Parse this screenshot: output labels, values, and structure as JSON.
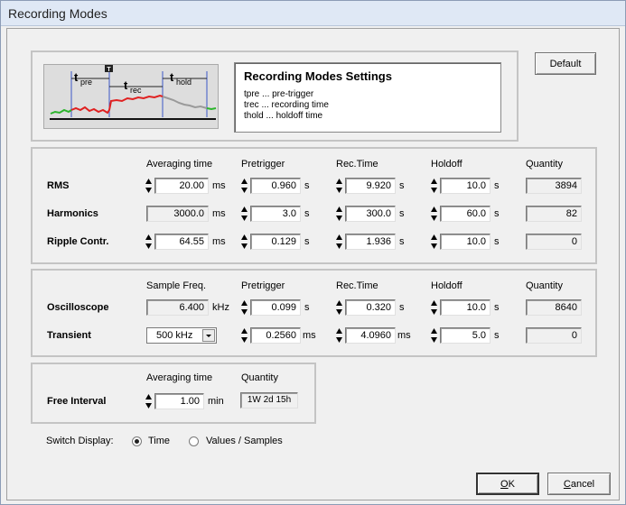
{
  "window": {
    "title": "Recording Modes"
  },
  "top": {
    "settings_title": "Recording Modes Settings",
    "legend": [
      "tpre ... pre-trigger",
      "trec ... recording time",
      "thold ... holdoff time"
    ],
    "diagram": {
      "tpre": "pre",
      "trec": "rec",
      "thold": "hold",
      "t": "t",
      "trigger_marker": "T"
    },
    "default_button": "Default"
  },
  "group1": {
    "headers": [
      "Averaging time",
      "Pretrigger",
      "Rec.Time",
      "Holdoff",
      "Quantity"
    ],
    "rows": [
      {
        "label": "RMS",
        "avg": "20.00",
        "avg_unit": "ms",
        "pre": "0.960",
        "pre_unit": "s",
        "rec": "9.920",
        "rec_unit": "s",
        "hold": "10.0",
        "hold_unit": "s",
        "qty": "3894"
      },
      {
        "label": "Harmonics",
        "avg": "3000.0",
        "avg_unit": "ms",
        "pre": "3.0",
        "pre_unit": "s",
        "rec": "300.0",
        "rec_unit": "s",
        "hold": "60.0",
        "hold_unit": "s",
        "qty": "82"
      },
      {
        "label": "Ripple Contr.",
        "avg": "64.55",
        "avg_unit": "ms",
        "pre": "0.129",
        "pre_unit": "s",
        "rec": "1.936",
        "rec_unit": "s",
        "hold": "10.0",
        "hold_unit": "s",
        "qty": "0"
      }
    ]
  },
  "group2": {
    "headers": [
      "Sample Freq.",
      "Pretrigger",
      "Rec.Time",
      "Holdoff",
      "Quantity"
    ],
    "oscilloscope": {
      "label": "Oscilloscope",
      "freq": "6.400",
      "freq_unit": "kHz",
      "pre": "0.099",
      "pre_unit": "s",
      "rec": "0.320",
      "rec_unit": "s",
      "hold": "10.0",
      "hold_unit": "s",
      "qty": "8640"
    },
    "transient": {
      "label": "Transient",
      "freq_selected": "500 kHz",
      "pre": "0.2560",
      "pre_unit": "ms",
      "rec": "4.0960",
      "rec_unit": "ms",
      "hold": "5.0",
      "hold_unit": "s",
      "qty": "0"
    }
  },
  "group3": {
    "headers": [
      "Averaging time",
      "Quantity"
    ],
    "label": "Free Interval",
    "avg": "1.00",
    "avg_unit": "min",
    "qty": "1W 2d 15h"
  },
  "switch_display": {
    "label": "Switch Display:",
    "options": [
      "Time",
      "Values / Samples"
    ],
    "selected": "Time"
  },
  "footer": {
    "ok": "OK",
    "ok_access": "O",
    "ok_rest": "K",
    "cancel": "Cancel",
    "cancel_access": "C",
    "cancel_rest": "ancel"
  }
}
